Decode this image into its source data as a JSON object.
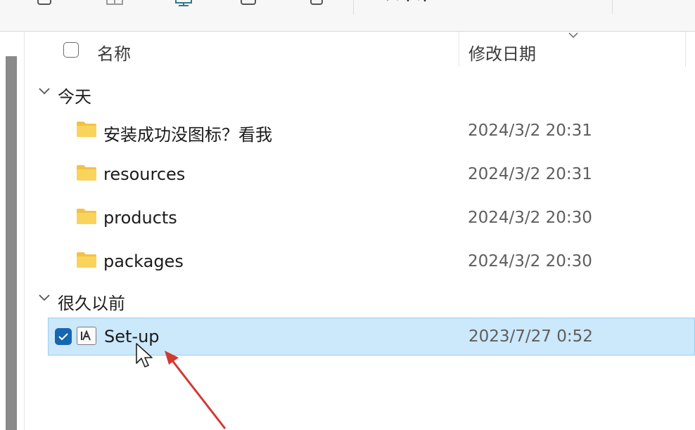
{
  "columns": {
    "name": "名称",
    "date_modified": "修改日期"
  },
  "groups": [
    {
      "label": "今天",
      "items": [
        {
          "name": "安装成功没图标？看我",
          "date": "2024/3/2 20:31",
          "type": "folder"
        },
        {
          "name": "resources",
          "date": "2024/3/2 20:31",
          "type": "folder"
        },
        {
          "name": "products",
          "date": "2024/3/2 20:30",
          "type": "folder"
        },
        {
          "name": "packages",
          "date": "2024/3/2 20:30",
          "type": "folder"
        }
      ]
    },
    {
      "label": "很久以前",
      "items": [
        {
          "name": "Set-up",
          "date": "2023/7/27 0:52",
          "type": "application",
          "selected": true
        }
      ]
    }
  ],
  "colors": {
    "selection_bg": "#cce8fb",
    "checkbox_accent": "#1766b1",
    "folder_yellow": "#f6c94e",
    "annotation_arrow": "#d03a32"
  }
}
